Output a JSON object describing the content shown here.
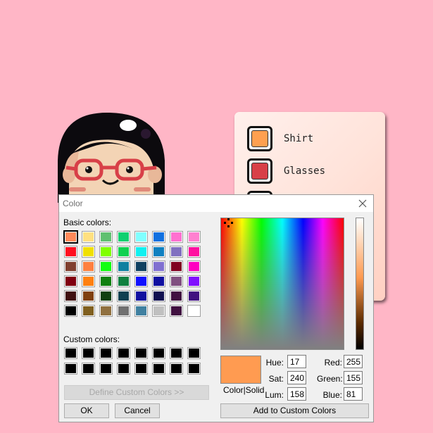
{
  "side_panel": {
    "options": [
      {
        "label": "Shirt",
        "color": "#ffa050"
      },
      {
        "label": "Glasses",
        "color": "#d84048"
      },
      {
        "label": "",
        "color": "#ffffff"
      }
    ]
  },
  "dialog": {
    "title": "Color",
    "basic_colors_label": "Basic colors:",
    "custom_colors_label": "Custom colors:",
    "define_custom_label": "Define Custom Colors >>",
    "ok_label": "OK",
    "cancel_label": "Cancel",
    "add_custom_label": "Add to Custom Colors",
    "color_solid_label": "Color|Solid",
    "selected_color": "#ff9b51",
    "hue_label": "Hue:",
    "hue": "17",
    "sat_label": "Sat:",
    "sat": "240",
    "lum_label": "Lum:",
    "lum": "158",
    "red_label": "Red:",
    "red": "255",
    "green_label": "Green:",
    "green": "155",
    "blue_label": "Blue:",
    "blue": "81",
    "basic_colors": [
      [
        "#ff8a5a",
        "#ffe080",
        "#60c070",
        "#10d070",
        "#80ffff",
        "#1070e0",
        "#ff70d0",
        "#ff80d0"
      ],
      [
        "#ff1020",
        "#f0e000",
        "#80ff00",
        "#10d050",
        "#10f0f0",
        "#1080c0",
        "#8070c0",
        "#ff10a0"
      ],
      [
        "#804030",
        "#ff8040",
        "#10ff10",
        "#1080a0",
        "#104060",
        "#8070d0",
        "#800020",
        "#ff00c0"
      ],
      [
        "#800010",
        "#ff8010",
        "#108010",
        "#108040",
        "#1010ff",
        "#1010a0",
        "#805080",
        "#8010ff"
      ],
      [
        "#401010",
        "#804010",
        "#104010",
        "#104050",
        "#1010a0",
        "#101050",
        "#401040",
        "#401080"
      ],
      [
        "#000000",
        "#806020",
        "#907040",
        "#707070",
        "#4080a0",
        "#c0c0c0",
        "#401040",
        "#ffffff"
      ]
    ],
    "custom_colors": [
      [
        "#000000",
        "#000000",
        "#000000",
        "#000000",
        "#000000",
        "#000000",
        "#000000",
        "#000000"
      ],
      [
        "#000000",
        "#000000",
        "#000000",
        "#000000",
        "#000000",
        "#000000",
        "#000000",
        "#000000"
      ]
    ]
  }
}
